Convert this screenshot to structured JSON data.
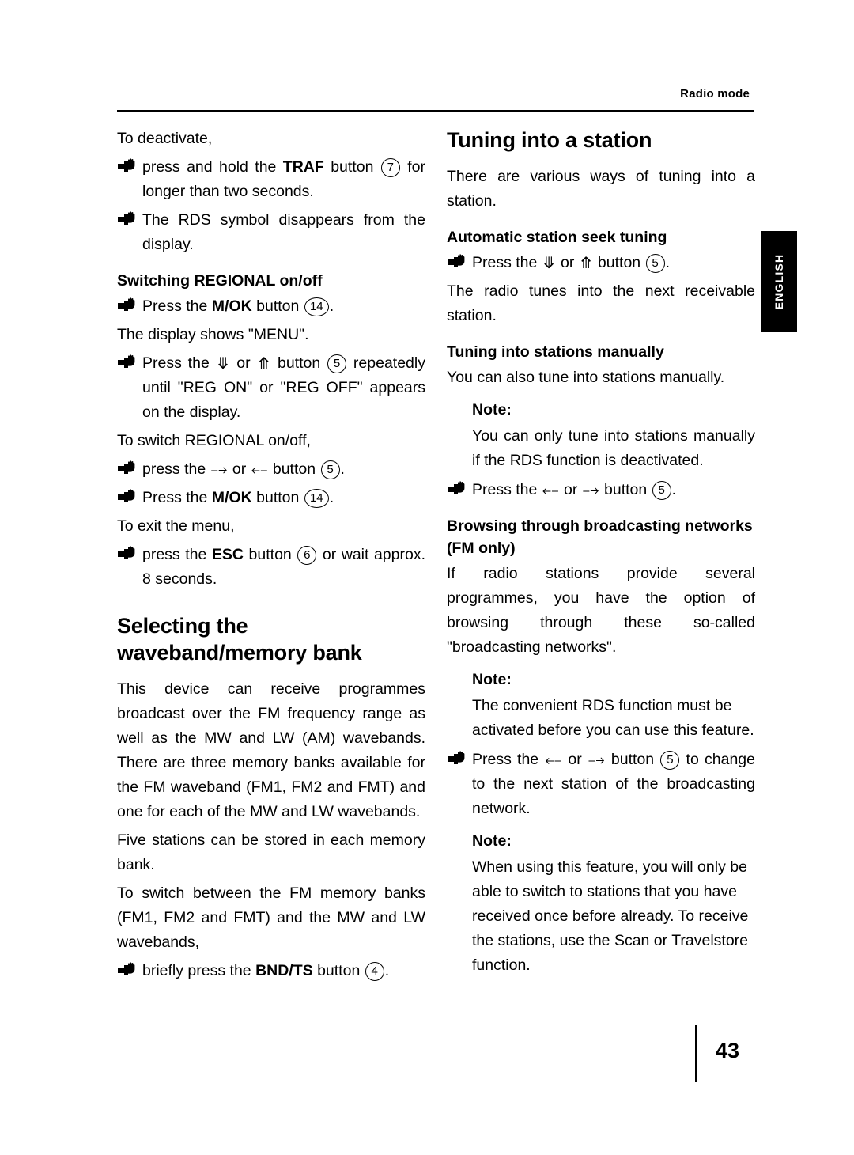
{
  "header": {
    "running_head": "Radio mode",
    "side_tab": "ENGLISH"
  },
  "footer": {
    "page_number": "43"
  },
  "left_column": {
    "intro": "To deactivate,",
    "b1_pre": "press and hold the ",
    "b1_bold": "TRAF",
    "b1_mid": " button ",
    "b1_num": "7",
    "b1_post": " for longer than two seconds.",
    "b2": "The RDS symbol disappears from the display.",
    "h_regional": "Switching REGIONAL on/off",
    "b3_pre": "Press the ",
    "b3_bold": "M/OK",
    "b3_mid": " button ",
    "b3_num": "14",
    "b3_post": ".",
    "p_menu": "The display shows \"MENU\".",
    "b4_pre": "Press the ",
    "b4_or": " or ",
    "b4_mid": " button ",
    "b4_num": "5",
    "b4_post": " repeatedly until \"REG ON\" or \"REG OFF\" appears on the display.",
    "p_switch": "To switch REGIONAL on/off,",
    "b5_pre": "press the ",
    "b5_or": " or ",
    "b5_mid": " button ",
    "b5_num": "5",
    "b5_post": ".",
    "b6_pre": "Press the ",
    "b6_bold": "M/OK",
    "b6_mid": " button ",
    "b6_num": "14",
    "b6_post": ".",
    "p_exit": "To exit the menu,",
    "b7_pre": "press the ",
    "b7_bold": "ESC",
    "b7_mid": " button ",
    "b7_num": "6",
    "b7_post": " or wait approx. 8 seconds.",
    "h_waveband": "Selecting the waveband/memory bank",
    "p_device": "This device can receive programmes broadcast over the FM frequency range as well as the MW and LW (AM) wavebands. There are three memory banks available for the FM waveband (FM1, FM2 and FMT) and one for each of the MW and LW wavebands.",
    "p_five": "Five stations can be stored in each memory bank.",
    "p_toswitch": "To switch between the FM memory banks (FM1, FM2 and FMT) and the MW and LW wavebands,",
    "b8_pre": "briefly press the ",
    "b8_bold": "BND/TS",
    "b8_mid": " button ",
    "b8_num": "4",
    "b8_post": "."
  },
  "right_column": {
    "h_tuning": "Tuning into a station",
    "p_various": "There are various ways of tuning into a station.",
    "h_auto": "Automatic station seek tuning",
    "b1_pre": "Press the ",
    "b1_or": " or ",
    "b1_mid": " button ",
    "b1_num": "5",
    "b1_post": ".",
    "p_radio_tunes": "The radio tunes into the next receivable station.",
    "h_manual": "Tuning into stations manually",
    "p_youcan": "You can also tune into stations manually.",
    "note1_head": "Note:",
    "note1_body": "You can only tune into stations manually if the RDS function is deactivated.",
    "b2_pre": "Press the ",
    "b2_or": " or ",
    "b2_mid": " button ",
    "b2_num": "5",
    "b2_post": ".",
    "h_browsing": "Browsing through broadcasting networks (FM only)",
    "p_ifradio": "If radio stations provide several programmes, you have the option of browsing through these so-called \"broadcasting networks\".",
    "note2_head": "Note:",
    "note2_body": "The convenient RDS function must be activated before you can use this feature.",
    "b3_pre": "Press the ",
    "b3_or": " or ",
    "b3_mid": " button ",
    "b3_num": "5",
    "b3_post": " to change to the next station of the broadcasting network.",
    "note3_head": "Note:",
    "note3_body": "When using this feature, you will only be able to switch to stations that you have received once before already. To receive the stations, use the Scan or Travelstore function."
  }
}
